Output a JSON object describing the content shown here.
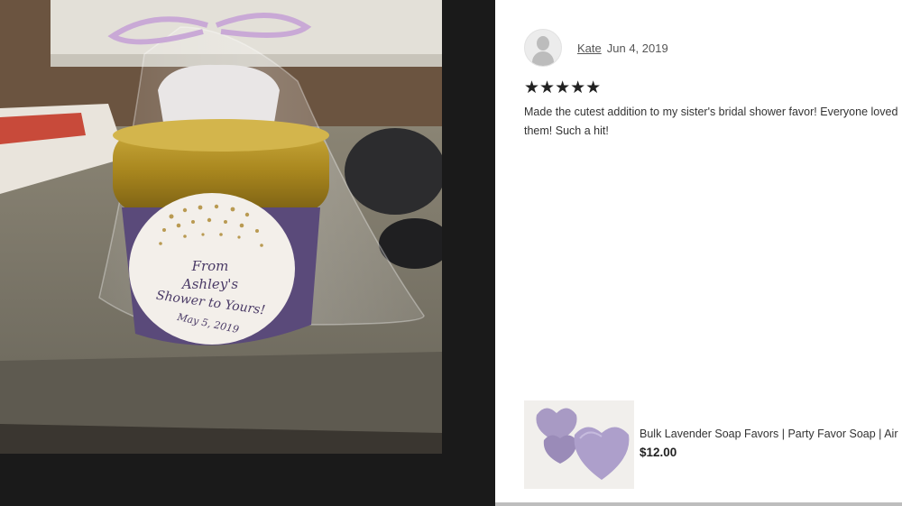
{
  "review": {
    "reviewer_name": "Kate",
    "date": "Jun 4, 2019",
    "rating": 5,
    "stars": "★★★★★",
    "text": "Made the cutest addition to my sister's bridal shower favor! Everyone loved them! Such a hit!"
  },
  "photo": {
    "tag_line1": "From",
    "tag_line2": "Ashley's",
    "tag_line3": "Shower to Yours!",
    "tag_line4": "May 5, 2019"
  },
  "product": {
    "title": "Bulk Lavender Soap Favors | Party Favor Soap | Air",
    "price": "$12.00"
  },
  "icons": {
    "avatar": "user-avatar-icon"
  }
}
